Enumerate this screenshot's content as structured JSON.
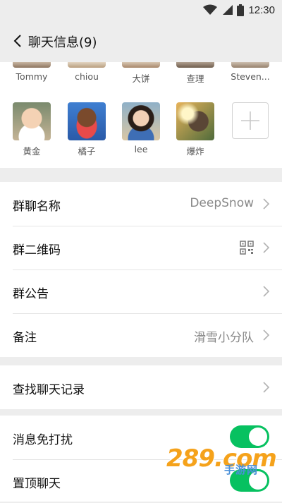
{
  "status_bar": {
    "time": "12:30",
    "icons": [
      "wifi-icon",
      "signal-icon",
      "battery-icon"
    ]
  },
  "nav": {
    "back_icon": "chevron-left-icon",
    "title": "聊天信息(9)"
  },
  "members": {
    "row1": [
      {
        "name": "Tommy"
      },
      {
        "name": "chiou"
      },
      {
        "name": "大饼"
      },
      {
        "name": "查理"
      },
      {
        "name": "Steven..."
      }
    ],
    "row2": [
      {
        "name": "黄金"
      },
      {
        "name": "橘子"
      },
      {
        "name": "lee"
      },
      {
        "name": "爆炸"
      }
    ],
    "add_icon": "plus-icon"
  },
  "settings": {
    "group_name": {
      "label": "群聊名称",
      "value": "DeepSnow"
    },
    "qr_code": {
      "label": "群二维码",
      "icon": "qr-code-icon"
    },
    "announcement": {
      "label": "群公告"
    },
    "remark": {
      "label": "备注",
      "value": "滑雪小分队"
    },
    "search_history": {
      "label": "查找聊天记录"
    },
    "mute": {
      "label": "消息免打扰",
      "on": true
    },
    "pin": {
      "label": "置顶聊天",
      "on": true
    }
  },
  "colors": {
    "toggle_on": "#07c160",
    "background": "#ededed",
    "value_text": "#888888"
  },
  "watermark": {
    "main": "289.com",
    "sub": "手游网"
  }
}
